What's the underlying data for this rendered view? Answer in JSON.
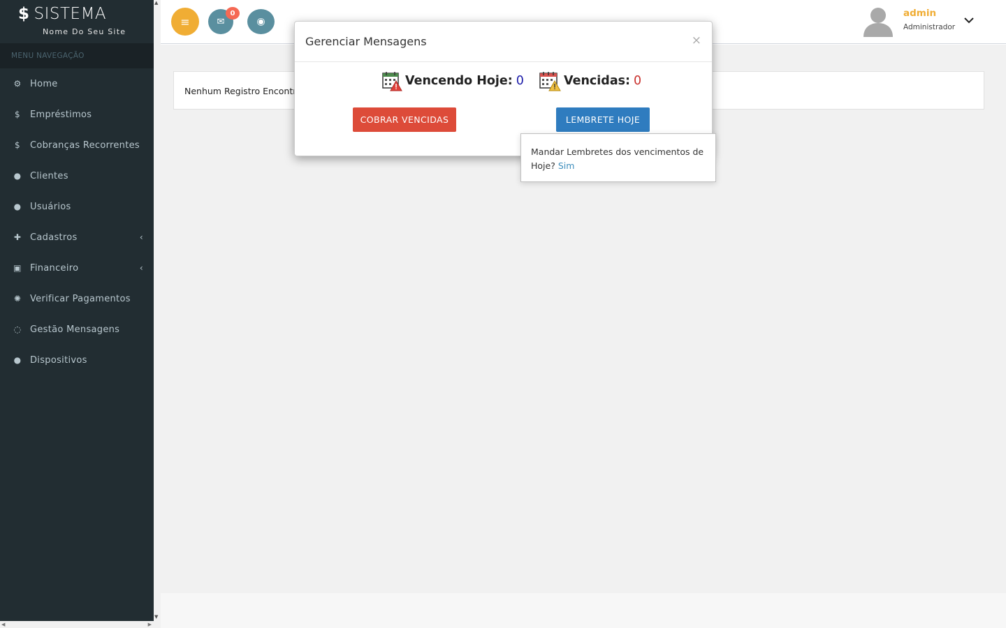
{
  "brand": {
    "symbol": "$",
    "title": "SISTEMA",
    "subtitle": "Nome Do Seu Site"
  },
  "sidebar": {
    "header": "MENU NAVEGAÇÃO",
    "items": [
      {
        "label": "Home",
        "icon": "dashboard-icon",
        "glyph": "⚙"
      },
      {
        "label": "Empréstimos",
        "icon": "dollar-icon",
        "glyph": "$"
      },
      {
        "label": "Cobranças Recorrentes",
        "icon": "dollar-icon",
        "glyph": "$"
      },
      {
        "label": "Clientes",
        "icon": "user-icon",
        "glyph": "●"
      },
      {
        "label": "Usuários",
        "icon": "users-icon",
        "glyph": "●"
      },
      {
        "label": "Cadastros",
        "icon": "plus-icon",
        "glyph": "✚",
        "has_submenu": true
      },
      {
        "label": "Financeiro",
        "icon": "money-icon",
        "glyph": "▣",
        "has_submenu": true
      },
      {
        "label": "Verificar Pagamentos",
        "icon": "spinner-icon",
        "glyph": "✺"
      },
      {
        "label": "Gestão Mensagens",
        "icon": "whatsapp-icon",
        "glyph": "◌"
      },
      {
        "label": "Dispositivos",
        "icon": "user-icon",
        "glyph": "●"
      }
    ]
  },
  "navbar": {
    "menu_glyph": "≡",
    "mail_glyph": "✉",
    "eye_glyph": "◉",
    "mail_badge": "0",
    "user": {
      "name": "admin",
      "role": "Administrador"
    }
  },
  "content": {
    "empty_message": "Nenhum Registro Encontrado"
  },
  "modal": {
    "title": "Gerenciar Mensagens",
    "close": "×",
    "due_today_label": "Vencendo Hoje:",
    "due_today_value": "0",
    "overdue_label": "Vencidas:",
    "overdue_value": "0",
    "charge_overdue_button": "COBRAR VENCIDAS",
    "remind_today_button": "LEMBRETE HOJE"
  },
  "popover": {
    "text": "Mandar Lembretes dos vencimentos de Hoje?",
    "link": "Sim"
  },
  "colors": {
    "sidebar_bg": "#222d32",
    "accent_orange": "#f0ad34",
    "teal": "#5a8f9f",
    "danger": "#dd4b39",
    "primary": "#2f7cbf",
    "link": "#3c8dbc"
  }
}
